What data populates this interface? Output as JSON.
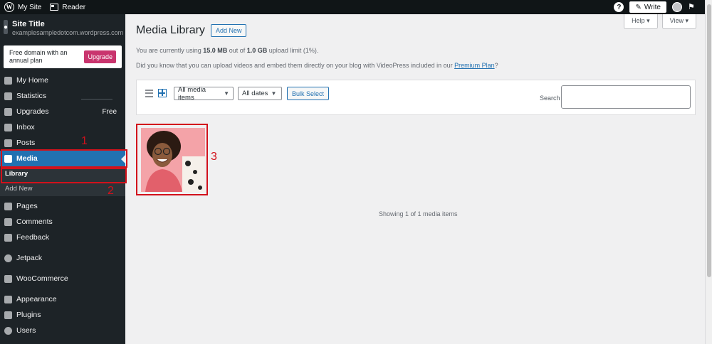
{
  "topbar": {
    "my_site": "My Site",
    "reader": "Reader",
    "help": "?",
    "write": "Write"
  },
  "sidebar": {
    "site_title": "Site Title",
    "site_url": "examplesampledotcom.wordpress.com",
    "promo_text": "Free domain with an annual plan",
    "upgrade": "Upgrade",
    "items": [
      {
        "label": "My Home",
        "icon": "home-icon"
      },
      {
        "label": "Statistics",
        "icon": "stats-icon"
      },
      {
        "label": "Upgrades",
        "icon": "upgrades-icon",
        "badge": "Free"
      },
      {
        "label": "Inbox",
        "icon": "inbox-icon"
      },
      {
        "label": "Posts",
        "icon": "pin-icon"
      },
      {
        "label": "Media",
        "icon": "media-icon",
        "active": true
      },
      {
        "label": "Pages",
        "icon": "pages-icon"
      },
      {
        "label": "Comments",
        "icon": "comments-icon"
      },
      {
        "label": "Feedback",
        "icon": "feedback-icon"
      },
      {
        "label": "Jetpack",
        "icon": "jetpack-icon"
      },
      {
        "label": "WooCommerce",
        "icon": "woo-icon"
      },
      {
        "label": "Appearance",
        "icon": "brush-icon"
      },
      {
        "label": "Plugins",
        "icon": "plug-icon"
      },
      {
        "label": "Users",
        "icon": "users-icon"
      }
    ],
    "submenu": {
      "library": "Library",
      "add_new": "Add New"
    }
  },
  "annotations": [
    "1",
    "2",
    "3"
  ],
  "main": {
    "title": "Media Library",
    "add_new": "Add New",
    "help_tab": "Help ▾",
    "view_tab": "View ▾",
    "usage_prefix": "You are currently using ",
    "usage_used": "15.0 MB",
    "usage_mid": " out of ",
    "usage_total": "1.0 GB",
    "usage_suffix": " upload limit (1%).",
    "videopress_text": "Did you know that you can upload videos and embed them directly on your blog with VideoPress included in our ",
    "premium_link": "Premium Plan",
    "videopress_end": "?",
    "filter_media": "All media items",
    "filter_dates": "All dates",
    "bulk_select": "Bulk Select",
    "search_label": "Search",
    "search_value": "",
    "showing": "Showing 1 of 1 media items"
  },
  "colors": {
    "accent": "#2271b1",
    "sidebar": "#1d2327",
    "annotation": "#d2111b",
    "thumb_background": "#f4a3a8"
  }
}
